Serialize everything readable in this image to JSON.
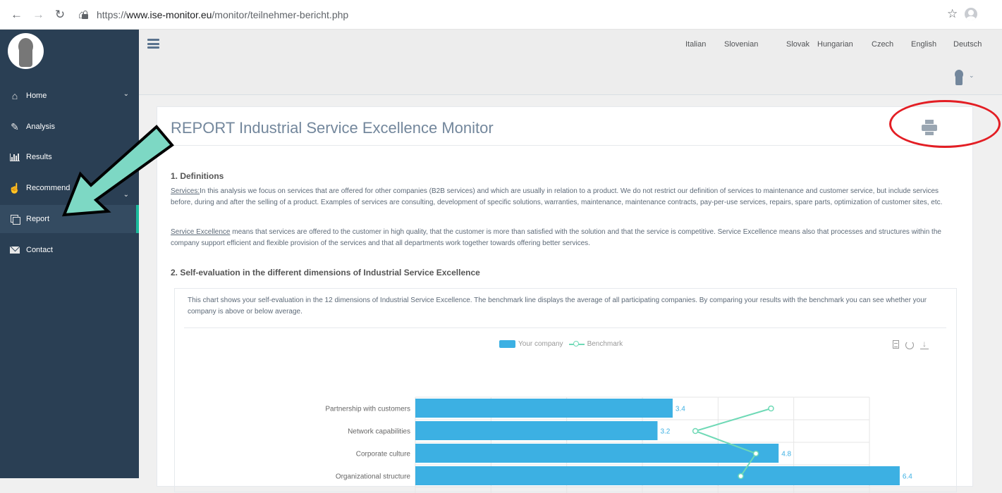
{
  "browser": {
    "url_scheme": "https://",
    "url_host": "www.ise-monitor.eu",
    "url_path": "/monitor/teilnehmer-bericht.php"
  },
  "sidebar": {
    "items": [
      {
        "label": "Home",
        "icon": "home-icon",
        "chevron": true
      },
      {
        "label": "Analysis",
        "icon": "edit-icon",
        "chevron": false
      },
      {
        "label": "Results",
        "icon": "bar-chart-icon",
        "chevron": false
      },
      {
        "label": "Recommend",
        "icon": "hand-point-icon",
        "chevron": true
      },
      {
        "label": "Report",
        "icon": "copy-icon",
        "chevron": false,
        "active": true
      },
      {
        "label": "Contact",
        "icon": "envelope-icon",
        "chevron": false
      }
    ]
  },
  "header": {
    "languages": [
      "Italian",
      "Slovenian",
      "Slovak",
      "Hungarian",
      "Czech",
      "English",
      "Deutsch"
    ]
  },
  "report": {
    "title": "REPORT Industrial Service Excellence Monitor",
    "section1_heading": "1. Definitions",
    "services_term": "Services:",
    "services_text": "In this analysis we focus on services that are offered for other companies (B2B services) and which are usually in relation to a product. We do not restrict our definition of services to maintenance and customer service, but include services before, during and after the selling of a product. Examples of services are consulting, development of specific solutions, warranties, maintenance, maintenance contracts, pay-per-use services, repairs, spare parts, optimization of customer sites, etc.",
    "excellence_term": "Service Excellence",
    "excellence_text": " means that services are offered to the customer in high quality, that the customer is more than satisfied with the solution and that the service is competitive. Service Excellence means also that processes and structures within the company support efficient and flexible provision of the services and that all departments work together towards offering better services.",
    "section2_heading": "2. Self-evaluation in the different dimensions of Industrial Service Excellence",
    "chart_description": "This chart shows your self-evaluation in the 12 dimensions of Industrial Service Excellence. The benchmark line displays the average of all participating companies. By comparing your results with the benchmark you can see whether your company is above or below average."
  },
  "colors": {
    "sidebar_bg": "#2a3f54",
    "accent": "#1abb9c",
    "bar": "#3cb0e3",
    "benchmark_line": "#6fd9b6",
    "annotation_red": "#e31e24",
    "annotation_arrow_fill": "#7dd8c4"
  },
  "chart_data": {
    "type": "bar",
    "orientation": "horizontal",
    "legend_position": "top-center",
    "grid": true,
    "categories": [
      "Partnership with customers",
      "Network capabilities",
      "Corporate culture",
      "Organizational structure"
    ],
    "series": [
      {
        "name": "Your company",
        "type": "bar",
        "values": [
          3.4,
          3.2,
          4.8,
          6.4
        ]
      },
      {
        "name": "Benchmark",
        "type": "line",
        "values": [
          4.7,
          3.7,
          4.5,
          4.3
        ]
      }
    ],
    "xlim": [
      0,
      6
    ]
  }
}
